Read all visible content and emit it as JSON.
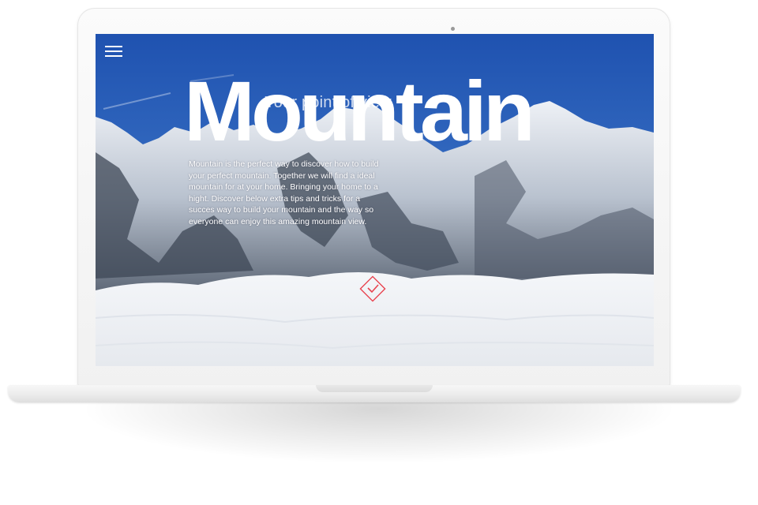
{
  "hero": {
    "subtitle": "Your point of view",
    "title": "Mountain",
    "description": "Mountain is the perfect way to discover how to build your perfect mountain. Together we will find a ideal mountain for at your home. Bringing your home to a hight. Discover below extra tips and tricks for a succes way to build your mountain and the way so everyone can enjoy this amazing mountain view."
  },
  "icons": {
    "menu": "hamburger-menu-icon",
    "scroll": "checkmark-diamond-icon",
    "camera": "webcam-dot"
  },
  "colors": {
    "sky": "#2f62b8",
    "accent": "#e8434f",
    "text": "#ffffff"
  }
}
